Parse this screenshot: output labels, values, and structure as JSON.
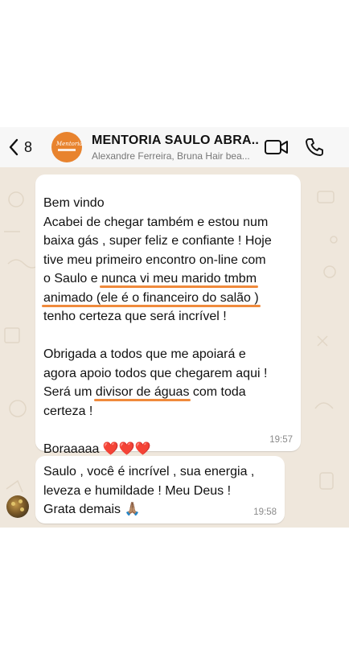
{
  "header": {
    "back_count": "8",
    "title": "MENTORIA SAULO ABRA...",
    "subtitle": "Alexandre Ferreira, Bruna Hair bea...",
    "avatar_color": "#e8832e"
  },
  "messages": [
    {
      "lines": [
        "Bem vindo",
        "Acabei de chegar também e estou num",
        "baixa gás , super feliz e confiante ! Hoje",
        "tive meu primeiro encontro on-line com",
        "o Saulo e ",
        "nunca vi meu marido tmbm",
        "animado (ele é o financeiro do salão )",
        "tenho certeza que será incrível !",
        "Obrigada a todos que me apoiará e",
        "agora apoio todos que chegarem aqui !",
        "Será um ",
        "divisor de águas",
        " com toda",
        "certeza !",
        "Boraaaaa ❤️❤️❤️"
      ],
      "time": "19:57"
    },
    {
      "lines": [
        "Saulo , você é incrível , sua energia ,",
        "leveza e humildade ! Meu Deus !",
        "Grata demais 🙏🏽"
      ],
      "time": "19:58"
    }
  ],
  "icons": {
    "back": "chevron-left-icon",
    "video": "video-camera-icon",
    "call": "phone-icon"
  },
  "colors": {
    "highlight": "#f08a3c",
    "chat_background": "#efe7dc",
    "header_background": "#f7f7f7"
  }
}
